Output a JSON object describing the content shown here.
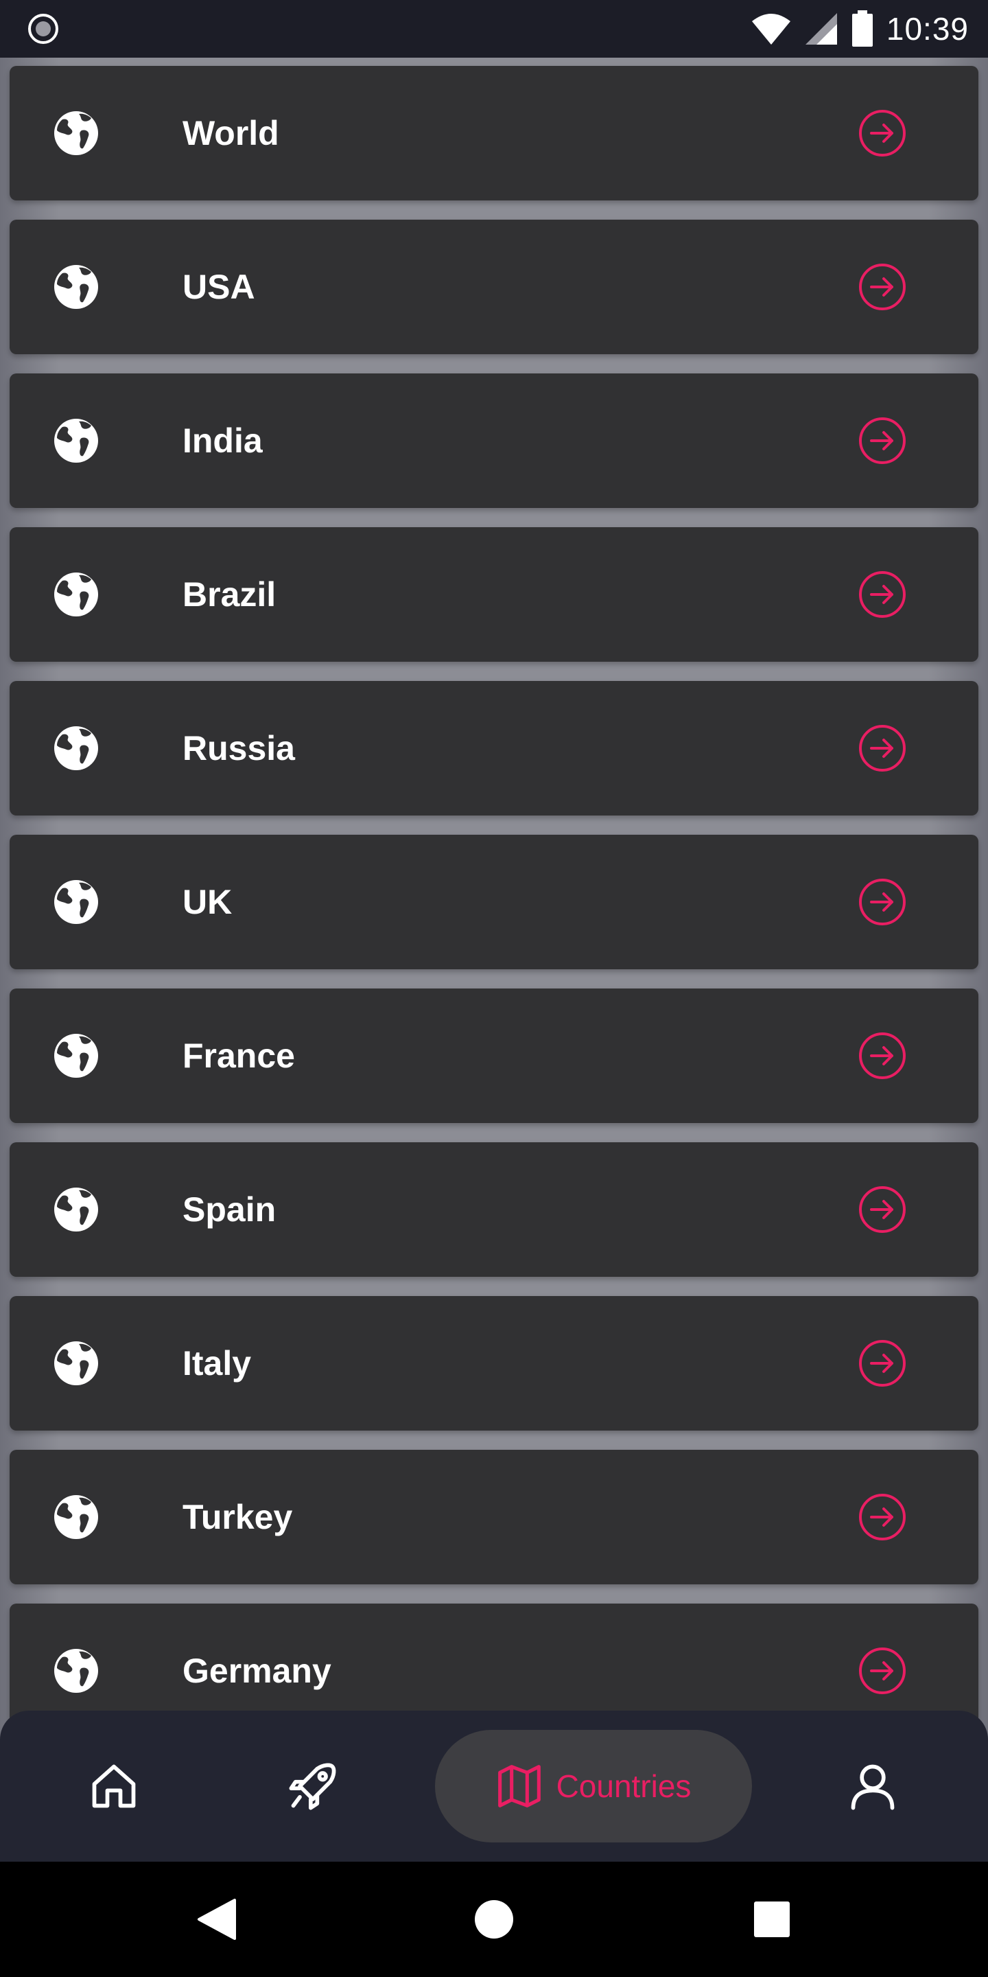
{
  "status_bar": {
    "time": "10:39",
    "left_icon": "record-circle-icon",
    "icons": [
      "wifi-icon",
      "cellular-signal-icon",
      "battery-icon"
    ]
  },
  "countries": {
    "items": [
      {
        "label": "World",
        "icon": "globe-icon",
        "action_icon": "arrow-right-circle-icon"
      },
      {
        "label": "USA",
        "icon": "globe-icon",
        "action_icon": "arrow-right-circle-icon"
      },
      {
        "label": "India",
        "icon": "globe-icon",
        "action_icon": "arrow-right-circle-icon"
      },
      {
        "label": "Brazil",
        "icon": "globe-icon",
        "action_icon": "arrow-right-circle-icon"
      },
      {
        "label": "Russia",
        "icon": "globe-icon",
        "action_icon": "arrow-right-circle-icon"
      },
      {
        "label": "UK",
        "icon": "globe-icon",
        "action_icon": "arrow-right-circle-icon"
      },
      {
        "label": "France",
        "icon": "globe-icon",
        "action_icon": "arrow-right-circle-icon"
      },
      {
        "label": "Spain",
        "icon": "globe-icon",
        "action_icon": "arrow-right-circle-icon"
      },
      {
        "label": "Italy",
        "icon": "globe-icon",
        "action_icon": "arrow-right-circle-icon"
      },
      {
        "label": "Turkey",
        "icon": "globe-icon",
        "action_icon": "arrow-right-circle-icon"
      },
      {
        "label": "Germany",
        "icon": "globe-icon",
        "action_icon": "arrow-right-circle-icon"
      }
    ]
  },
  "bottom_nav": {
    "items": [
      {
        "name": "home",
        "icon": "home-icon"
      },
      {
        "name": "rocket",
        "icon": "rocket-icon"
      },
      {
        "name": "countries",
        "icon": "map-icon",
        "label": "Countries",
        "active": true
      },
      {
        "name": "profile",
        "icon": "user-icon"
      }
    ]
  },
  "system_nav": {
    "icons": [
      "back-triangle-icon",
      "home-circle-icon",
      "recents-square-icon"
    ]
  },
  "colors": {
    "accent": "#e91e63",
    "card_background": "#313133",
    "status_bar_background": "#1c1d27",
    "bottom_nav_background": "#232532",
    "active_pill_background": "#3e3e42",
    "text_primary": "#ffffff"
  }
}
